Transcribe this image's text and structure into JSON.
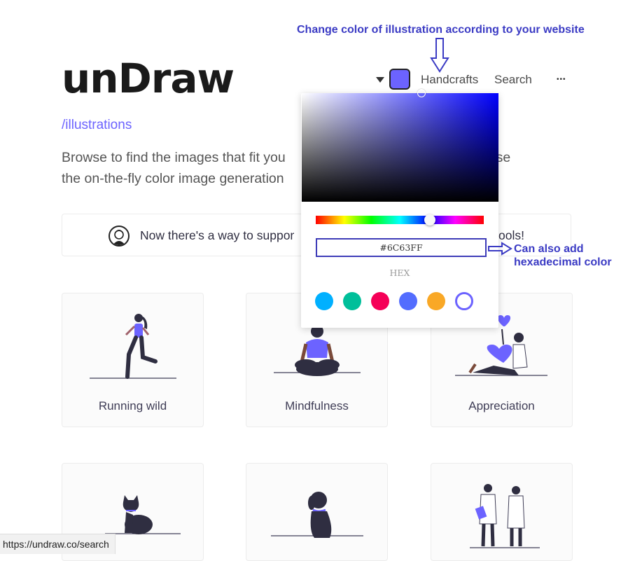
{
  "site": {
    "logo": "unDraw",
    "sublink": "/illustrations",
    "description_line1": "Browse to find the images that fit you",
    "description_line1_end": ". Use",
    "description_line2": "the on-the-fly color image generation"
  },
  "nav": {
    "color_swatch": "#6C63FF",
    "handcrafts": "Handcrafts",
    "search": "Search",
    "more": "•••"
  },
  "banner": {
    "text_left": "Now there's a way to suppor",
    "text_right": "ools!"
  },
  "color_picker": {
    "hex_value": "#6C63FF",
    "hex_label": "HEX",
    "presets": [
      "#00b0ff",
      "#00bf9a",
      "#f50057",
      "#536dfe",
      "#f9a826",
      "#6c63ff"
    ],
    "selected_preset": "#6c63ff"
  },
  "cards": [
    {
      "label": "Running wild"
    },
    {
      "label": "Mindfulness"
    },
    {
      "label": "Appreciation"
    },
    {
      "label": ""
    },
    {
      "label": ""
    },
    {
      "label": ""
    }
  ],
  "annotations": {
    "top": "Change color of illustration according to your website",
    "hex_line1": "Can also add",
    "hex_line2": "hexadecimal color"
  },
  "statusbar": {
    "url": "https://undraw.co/search"
  },
  "colors": {
    "accent": "#6c63ff",
    "annotation": "#3b3bc4",
    "dark": "#2f2e41"
  }
}
